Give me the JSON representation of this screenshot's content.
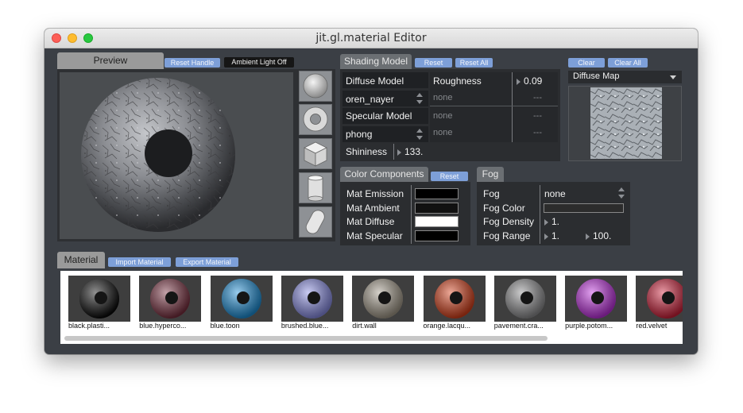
{
  "window": {
    "title": "jit.gl.material Editor"
  },
  "preview": {
    "tab_label": "Preview",
    "reset_handle": "Reset Handle",
    "ambient_light": "Ambient Light Off"
  },
  "shading": {
    "tab_label": "Shading Model",
    "reset": "Reset",
    "reset_all": "Reset All",
    "diffuse_model_label": "Diffuse Model",
    "diffuse_model_value": "oren_nayer",
    "specular_model_label": "Specular Model",
    "specular_model_value": "phong",
    "shininess_label": "Shininess",
    "shininess_value": "133.",
    "params": [
      {
        "name": "Roughness",
        "value": "0.09"
      },
      {
        "name": "none",
        "value": "---"
      },
      {
        "name": "none",
        "value": "---"
      },
      {
        "name": "none",
        "value": "---"
      }
    ]
  },
  "texture": {
    "clear": "Clear",
    "clear_all": "Clear All",
    "selected": "Diffuse Map"
  },
  "color_components": {
    "tab_label": "Color Components",
    "reset": "Reset",
    "items": [
      {
        "label": "Mat Emission",
        "color": "#000000"
      },
      {
        "label": "Mat Ambient",
        "color": "#111111"
      },
      {
        "label": "Mat Diffuse",
        "color": "#ffffff"
      },
      {
        "label": "Mat Specular",
        "color": "#000000"
      }
    ]
  },
  "fog": {
    "tab_label": "Fog",
    "fog_label": "Fog",
    "fog_value": "none",
    "color_label": "Fog Color",
    "color_value": "#2c2c2c",
    "density_label": "Fog Density",
    "density_value": "1.",
    "range_label": "Fog Range",
    "range_start": "1.",
    "range_end": "100."
  },
  "material": {
    "tab_label": "Material",
    "import": "Import Material",
    "export": "Export Material",
    "presets": [
      {
        "name": "black.plasti...",
        "color": "#0a0a0a"
      },
      {
        "name": "blue.hyperco...",
        "color": "#7a3040"
      },
      {
        "name": "blue.toon",
        "color": "#1c8fd8"
      },
      {
        "name": "brushed.blue...",
        "color": "#8a8ee6"
      },
      {
        "name": "dirt.wall",
        "color": "#a39a8a"
      },
      {
        "name": "orange.lacqu...",
        "color": "#d8401a"
      },
      {
        "name": "pavement.cra...",
        "color": "#8e8e90"
      },
      {
        "name": "purple.potom...",
        "color": "#c030e0"
      },
      {
        "name": "red.velvet",
        "color": "#d0203a"
      }
    ]
  },
  "shape_buttons": [
    "sphere-icon",
    "torus-icon",
    "cube-icon",
    "cylinder-icon",
    "capsule-icon"
  ]
}
